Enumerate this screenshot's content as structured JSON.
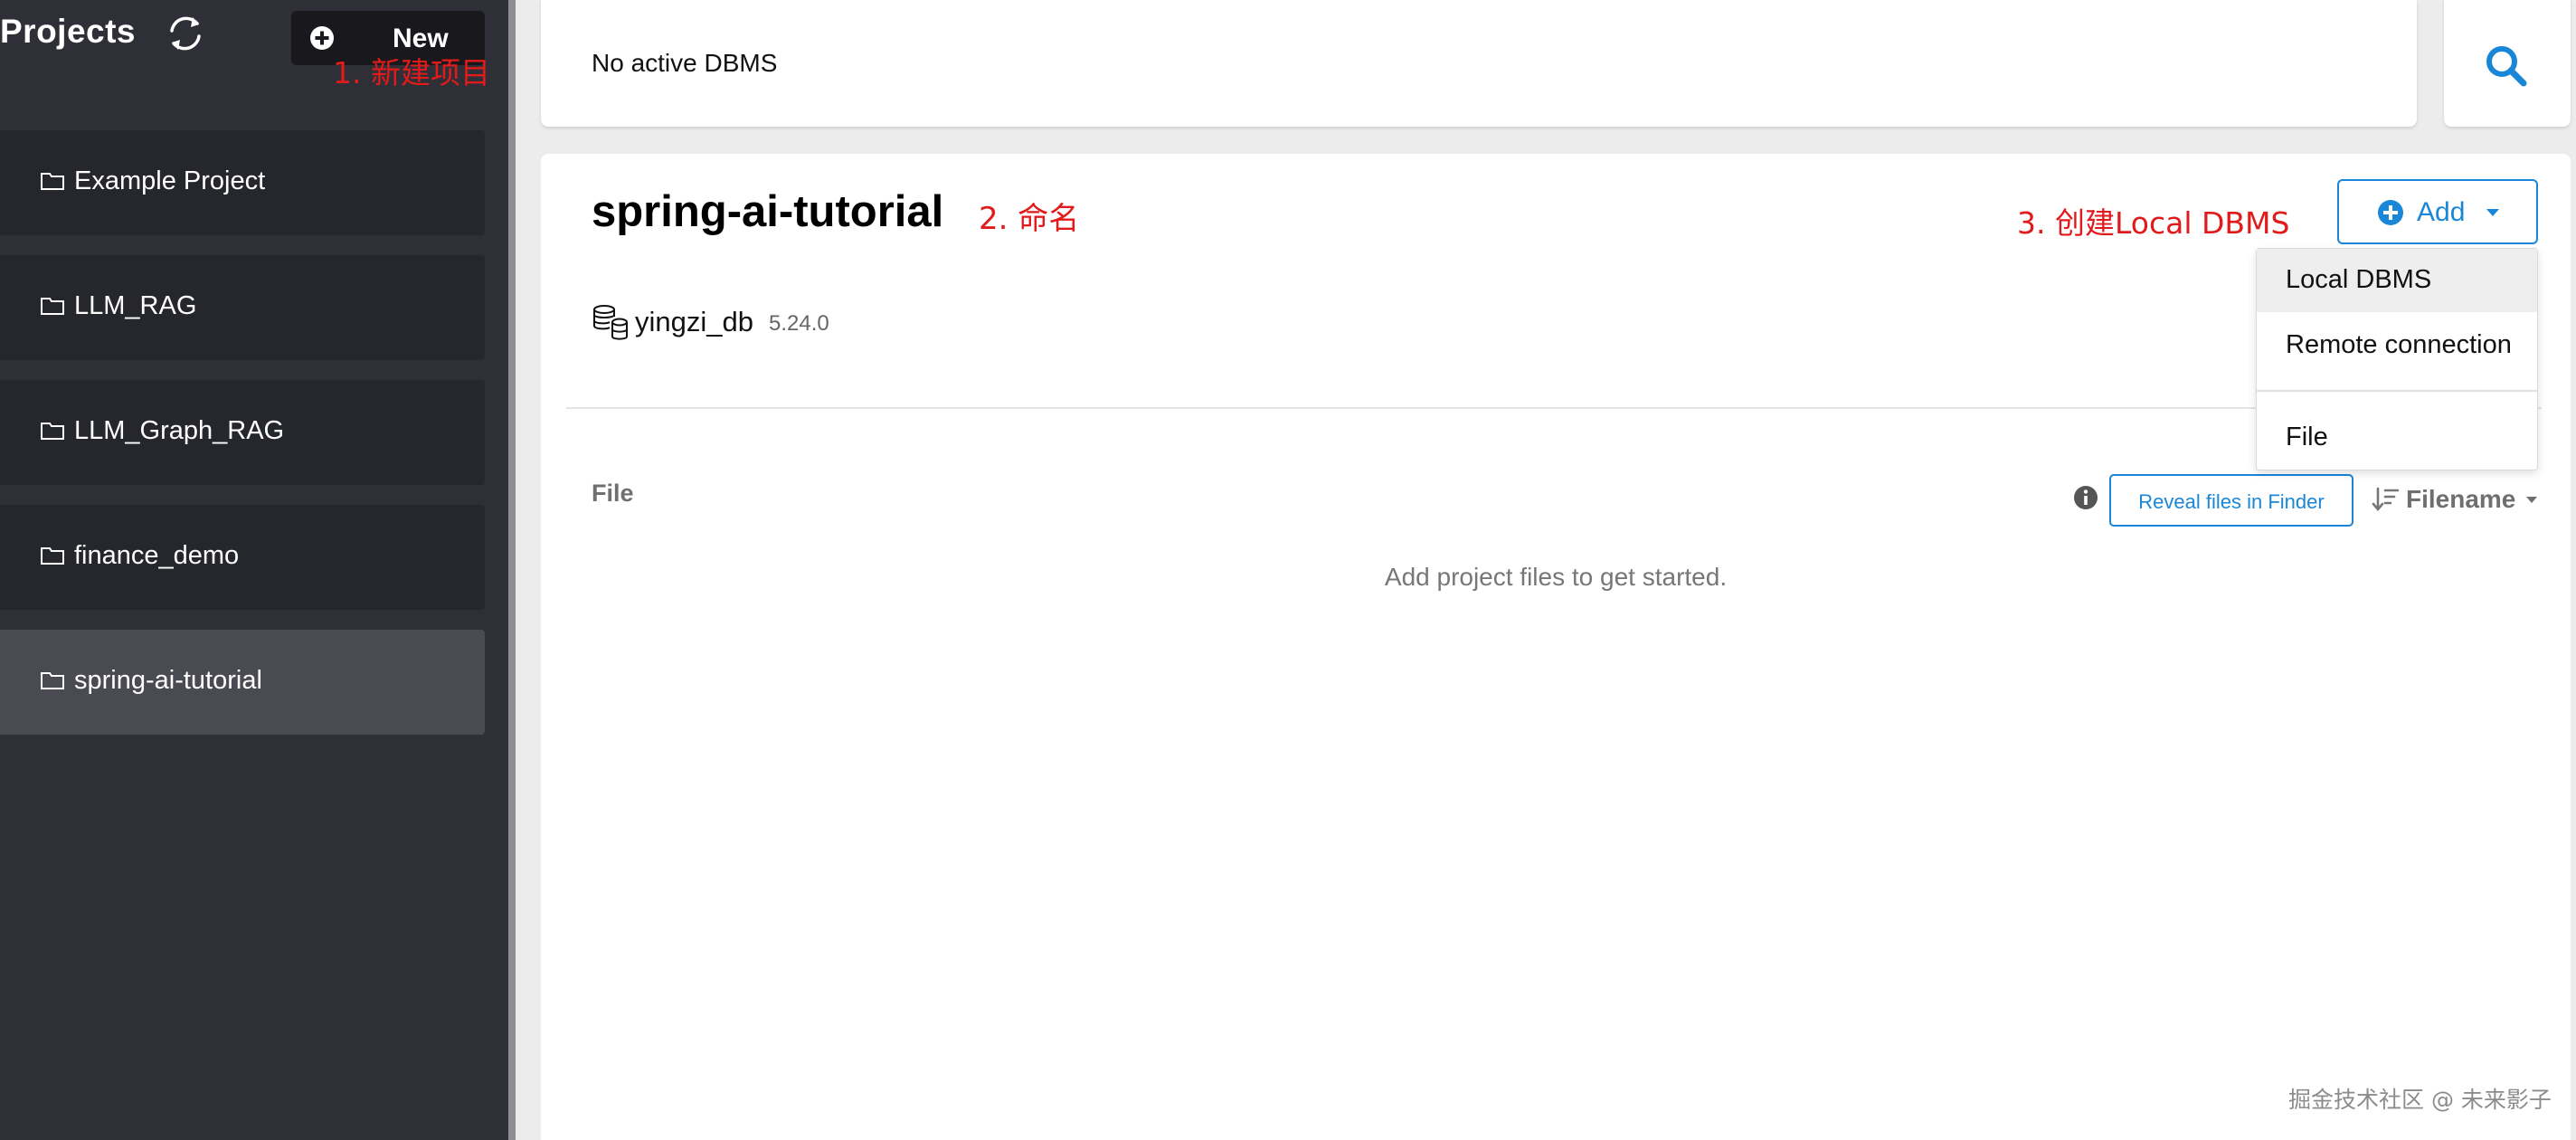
{
  "sidebar": {
    "title": "Projects",
    "new_button_label": "New",
    "projects": [
      {
        "label": "Example Project"
      },
      {
        "label": "LLM_RAG"
      },
      {
        "label": "LLM_Graph_RAG"
      },
      {
        "label": "finance_demo"
      },
      {
        "label": "spring-ai-tutorial",
        "active": true
      }
    ]
  },
  "status_bar": {
    "text": "No active DBMS"
  },
  "main": {
    "project_title": "spring-ai-tutorial",
    "add_button_label": "Add",
    "dbms": {
      "name": "yingzi_db",
      "version": "5.24.0"
    },
    "files": {
      "header": "File",
      "reveal_button_label": "Reveal files in Finder",
      "sort_label": "Filename",
      "empty_message": "Add project files to get started."
    }
  },
  "dropdown": {
    "items": [
      "Local DBMS",
      "Remote connection",
      "File"
    ]
  },
  "annotations": {
    "step1": "1. 新建项目",
    "step2": "2. 命名",
    "step3": "3. 创建Local DBMS"
  },
  "watermark": "掘金技术社区 @ 未来影子",
  "colors": {
    "sidebar_bg": "#2e2f37",
    "sidebar_item_bg": "#26272d",
    "sidebar_active_bg": "#4a4a52",
    "accent_blue": "#1a86d8",
    "annotation_red": "#e11b1b"
  },
  "icons": {
    "refresh": "refresh-icon",
    "new": "plus-circle-icon",
    "folder": "folder-icon",
    "search": "search-icon",
    "add": "plus-circle-icon",
    "database": "database-icon",
    "info": "info-icon",
    "sort": "sort-icon"
  }
}
